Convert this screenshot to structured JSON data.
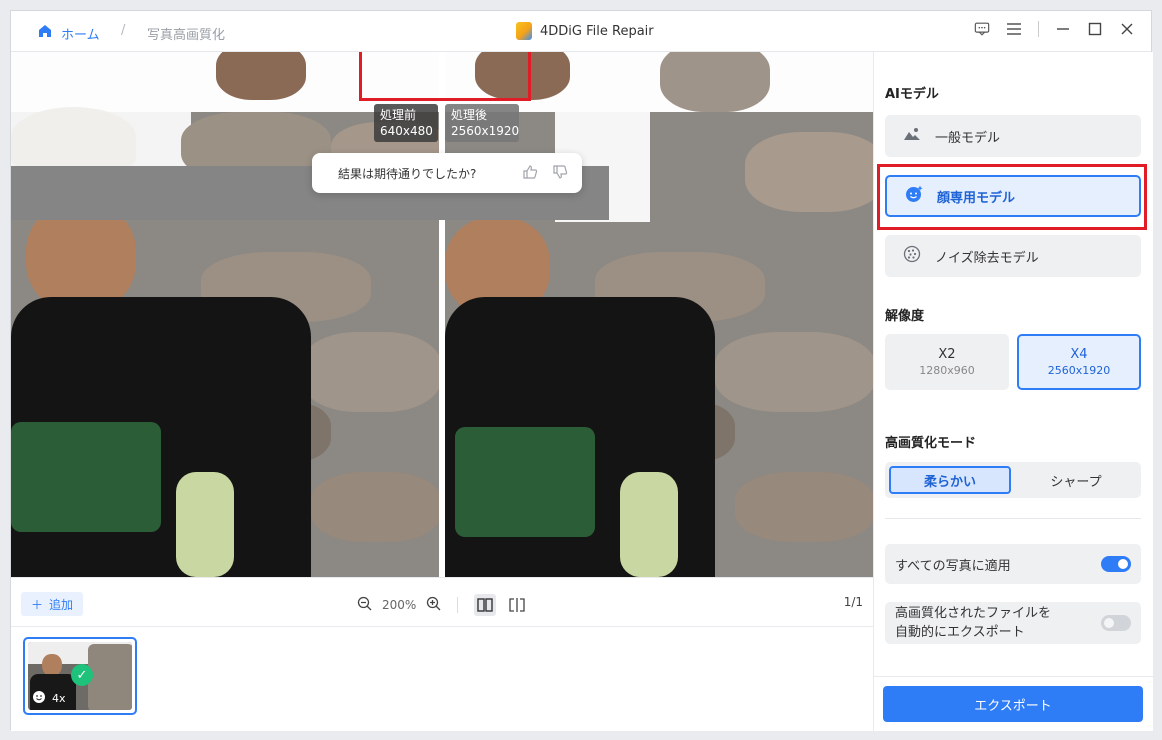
{
  "titlebar": {
    "home_label": "ホーム",
    "separator": "/",
    "breadcrumb": "写真高画質化",
    "app_title": "4DDiG File Repair"
  },
  "preview": {
    "before_label": "処理前",
    "before_size": "640x480",
    "after_label": "処理後",
    "after_size": "2560x1920",
    "feedback_question": "結果は期待通りでしたか?"
  },
  "toolbar": {
    "add_label": "追加",
    "zoom_level": "200%",
    "page_indicator": "1/1"
  },
  "thumbnail": {
    "scale_label": "4x"
  },
  "sidebar": {
    "ai_model_title": "AIモデル",
    "models": [
      {
        "label": "一般モデル",
        "icon": "landscape-icon",
        "selected": false
      },
      {
        "label": "顔専用モデル",
        "icon": "face-sparkle-icon",
        "selected": true
      },
      {
        "label": "ノイズ除去モデル",
        "icon": "noise-icon",
        "selected": false
      }
    ],
    "resolution_title": "解像度",
    "resolutions": [
      {
        "scale": "X2",
        "size": "1280x960",
        "selected": false
      },
      {
        "scale": "X4",
        "size": "2560x1920",
        "selected": true
      }
    ],
    "mode_title": "高画質化モード",
    "modes": [
      {
        "label": "柔らかい",
        "selected": true
      },
      {
        "label": "シャープ",
        "selected": false
      }
    ],
    "apply_all_label": "すべての写真に適用",
    "apply_all_on": true,
    "auto_export_label_line1": "高画質化されたファイルを",
    "auto_export_label_line2": "自動的にエクスポート",
    "auto_export_on": false,
    "export_label": "エクスポート"
  },
  "colors": {
    "accent": "#2f7df6",
    "highlight_box": "#e01d26",
    "check": "#1ec27b"
  }
}
